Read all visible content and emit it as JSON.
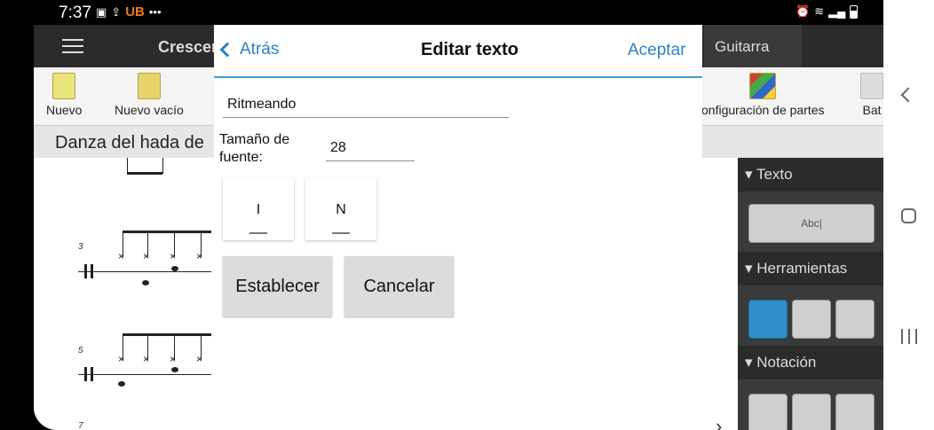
{
  "status_bar": {
    "time": "7:37",
    "icons": [
      "image-icon",
      "upload-icon",
      "ub-icon",
      "more-dots-icon"
    ],
    "right_icons": [
      "alarm-icon",
      "wifi-icon",
      "signal-icon",
      "battery-icon"
    ],
    "more": "•••",
    "ub": "UB"
  },
  "app": {
    "title": "Crescen",
    "tab_right": "Guitarra",
    "toolbar": [
      {
        "label": "Nuevo",
        "icon": "new-file-icon"
      },
      {
        "label": "Nuevo vacío",
        "icon": "new-empty-icon"
      },
      {
        "label": "onfiguración de partes",
        "icon": "parts-config-icon"
      },
      {
        "label": "Bat",
        "icon": "drums-icon"
      }
    ],
    "score_title": "Danza del hada de",
    "measures": [
      "3",
      "5",
      "7"
    ],
    "side_panel": {
      "sections": [
        "Texto",
        "Herramientas",
        "Notación"
      ],
      "text_button": "Abc|"
    }
  },
  "dialog": {
    "back_label": "Atrás",
    "title": "Editar texto",
    "accept_label": "Aceptar",
    "text_value": "Ritmeando",
    "font_size_label": "Tamaño de fuente:",
    "font_size_value": "28",
    "italic_label": "I",
    "bold_label": "N",
    "set_label": "Establecer",
    "cancel_label": "Cancelar"
  },
  "colors": {
    "accent": "#2b83c6",
    "divider": "#3d9ad6",
    "dark_bar": "#2b2b2b",
    "selected_tool": "#2f8fc6"
  }
}
